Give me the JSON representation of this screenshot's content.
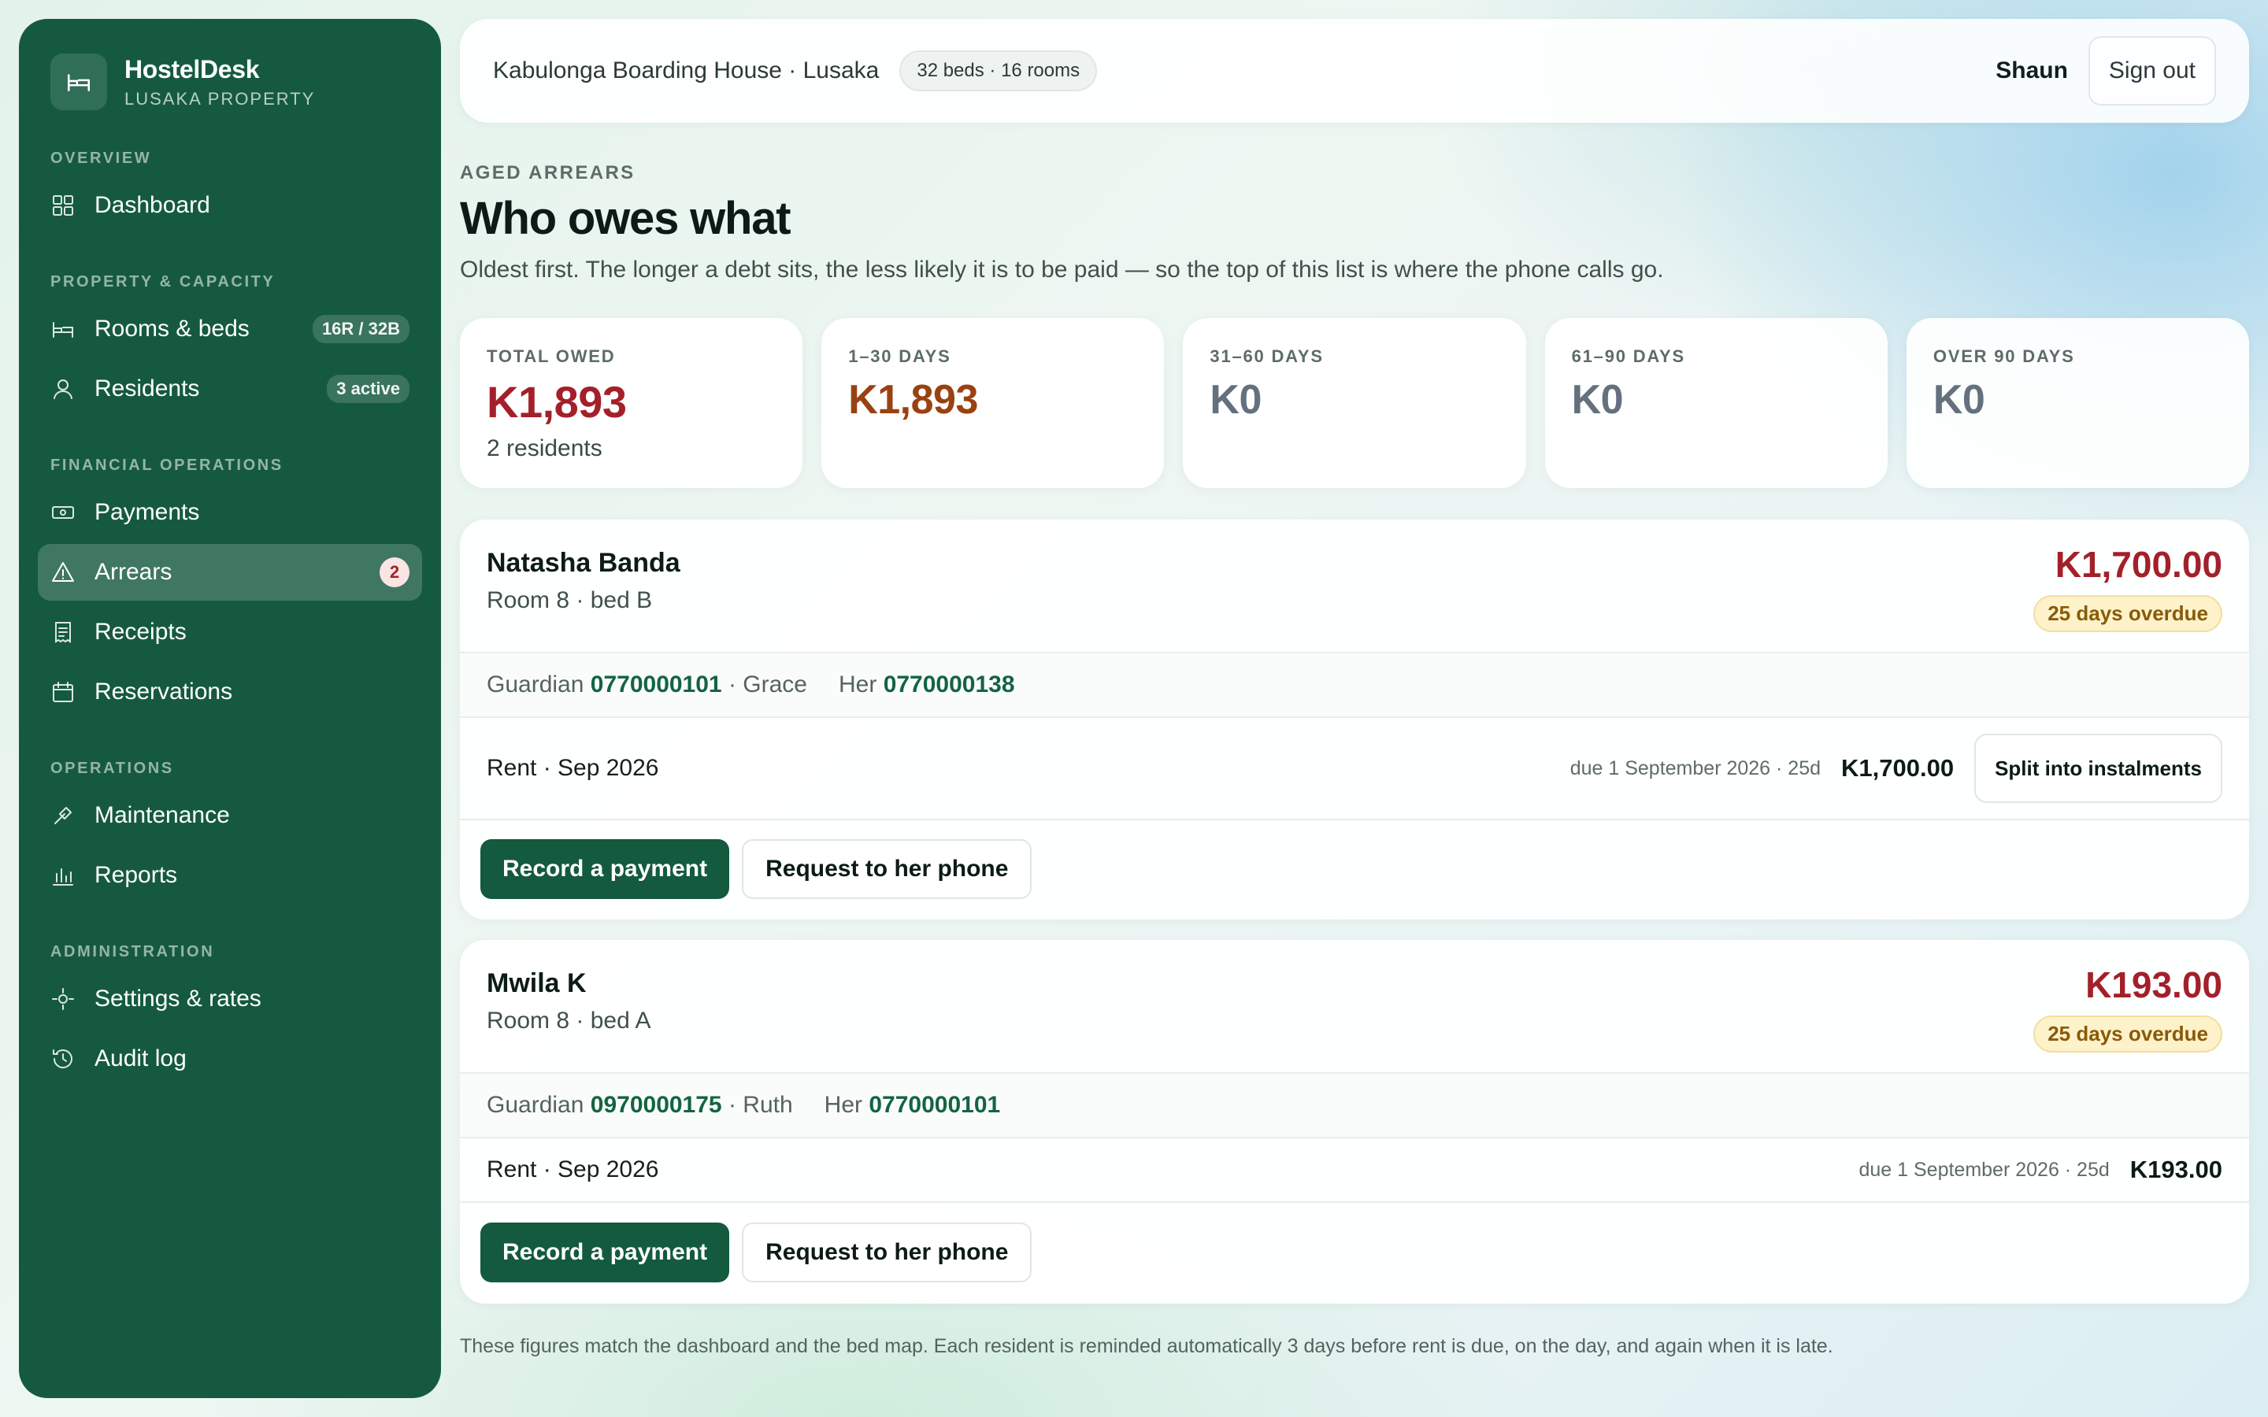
{
  "brand": {
    "name": "HostelDesk",
    "subtitle": "LUSAKA PROPERTY"
  },
  "sidebar": {
    "sections": [
      {
        "label": "OVERVIEW",
        "items": [
          {
            "label": "Dashboard",
            "icon": "grid-icon"
          }
        ]
      },
      {
        "label": "PROPERTY & CAPACITY",
        "items": [
          {
            "label": "Rooms & beds",
            "icon": "bed-icon",
            "pill": "16R / 32B"
          },
          {
            "label": "Residents",
            "icon": "user-icon",
            "pill": "3 active"
          }
        ]
      },
      {
        "label": "FINANCIAL OPERATIONS",
        "items": [
          {
            "label": "Payments",
            "icon": "cash-icon"
          },
          {
            "label": "Arrears",
            "icon": "warning-icon",
            "count": "2",
            "active": true
          },
          {
            "label": "Receipts",
            "icon": "receipt-icon"
          },
          {
            "label": "Reservations",
            "icon": "calendar-icon"
          }
        ]
      },
      {
        "label": "OPERATIONS",
        "items": [
          {
            "label": "Maintenance",
            "icon": "wrench-icon"
          },
          {
            "label": "Reports",
            "icon": "bar-chart-icon"
          }
        ]
      },
      {
        "label": "ADMINISTRATION",
        "items": [
          {
            "label": "Settings & rates",
            "icon": "gear-icon"
          },
          {
            "label": "Audit log",
            "icon": "history-icon"
          }
        ]
      }
    ]
  },
  "header": {
    "property": "Kabulonga Boarding House · Lusaka",
    "capacity": "32 beds · 16 rooms",
    "user": "Shaun",
    "signout": "Sign out"
  },
  "page": {
    "eyebrow": "AGED ARREARS",
    "title": "Who owes what",
    "subtitle": "Oldest first. The longer a debt sits, the less likely it is to be paid — so the top of this list is where the phone calls go."
  },
  "summary": [
    {
      "label": "TOTAL OWED",
      "value": "K1,893",
      "note": "2 residents",
      "tone": "red"
    },
    {
      "label": "1–30 DAYS",
      "value": "K1,893",
      "note": "",
      "tone": "amber"
    },
    {
      "label": "31–60 DAYS",
      "value": "K0",
      "note": "",
      "tone": "grey"
    },
    {
      "label": "61–90 DAYS",
      "value": "K0",
      "note": "",
      "tone": "grey"
    },
    {
      "label": "OVER 90 DAYS",
      "value": "K0",
      "note": "",
      "tone": "grey"
    }
  ],
  "residents": [
    {
      "name": "Natasha Banda",
      "room": "Room 8 · bed B",
      "amount": "K1,700.00",
      "overdue": "25 days overdue",
      "guardian_label": "Guardian",
      "guardian_phone": "0770000101",
      "guardian_name": "· Grace",
      "her_label": "Her",
      "her_phone": "0770000138",
      "charge_label": "Rent · Sep 2026",
      "charge_due": "due 1 September 2026 · 25d",
      "charge_amount": "K1,700.00",
      "split_label": "Split into instalments",
      "record_label": "Record a payment",
      "request_label": "Request to her phone"
    },
    {
      "name": "Mwila K",
      "room": "Room 8 · bed A",
      "amount": "K193.00",
      "overdue": "25 days overdue",
      "guardian_label": "Guardian",
      "guardian_phone": "0970000175",
      "guardian_name": "· Ruth",
      "her_label": "Her",
      "her_phone": "0770000101",
      "charge_label": "Rent · Sep 2026",
      "charge_due": "due 1 September 2026 · 25d",
      "charge_amount": "K193.00",
      "record_label": "Record a payment",
      "request_label": "Request to her phone"
    }
  ],
  "footnote": "These figures match the dashboard and the bed map. Each resident is reminded automatically 3 days before rent is due, on the day, and again when it is late.",
  "colors": {
    "sidebar": "#155a40",
    "danger": "#a3202a",
    "amber": "#9a4111",
    "accent": "#146442"
  }
}
